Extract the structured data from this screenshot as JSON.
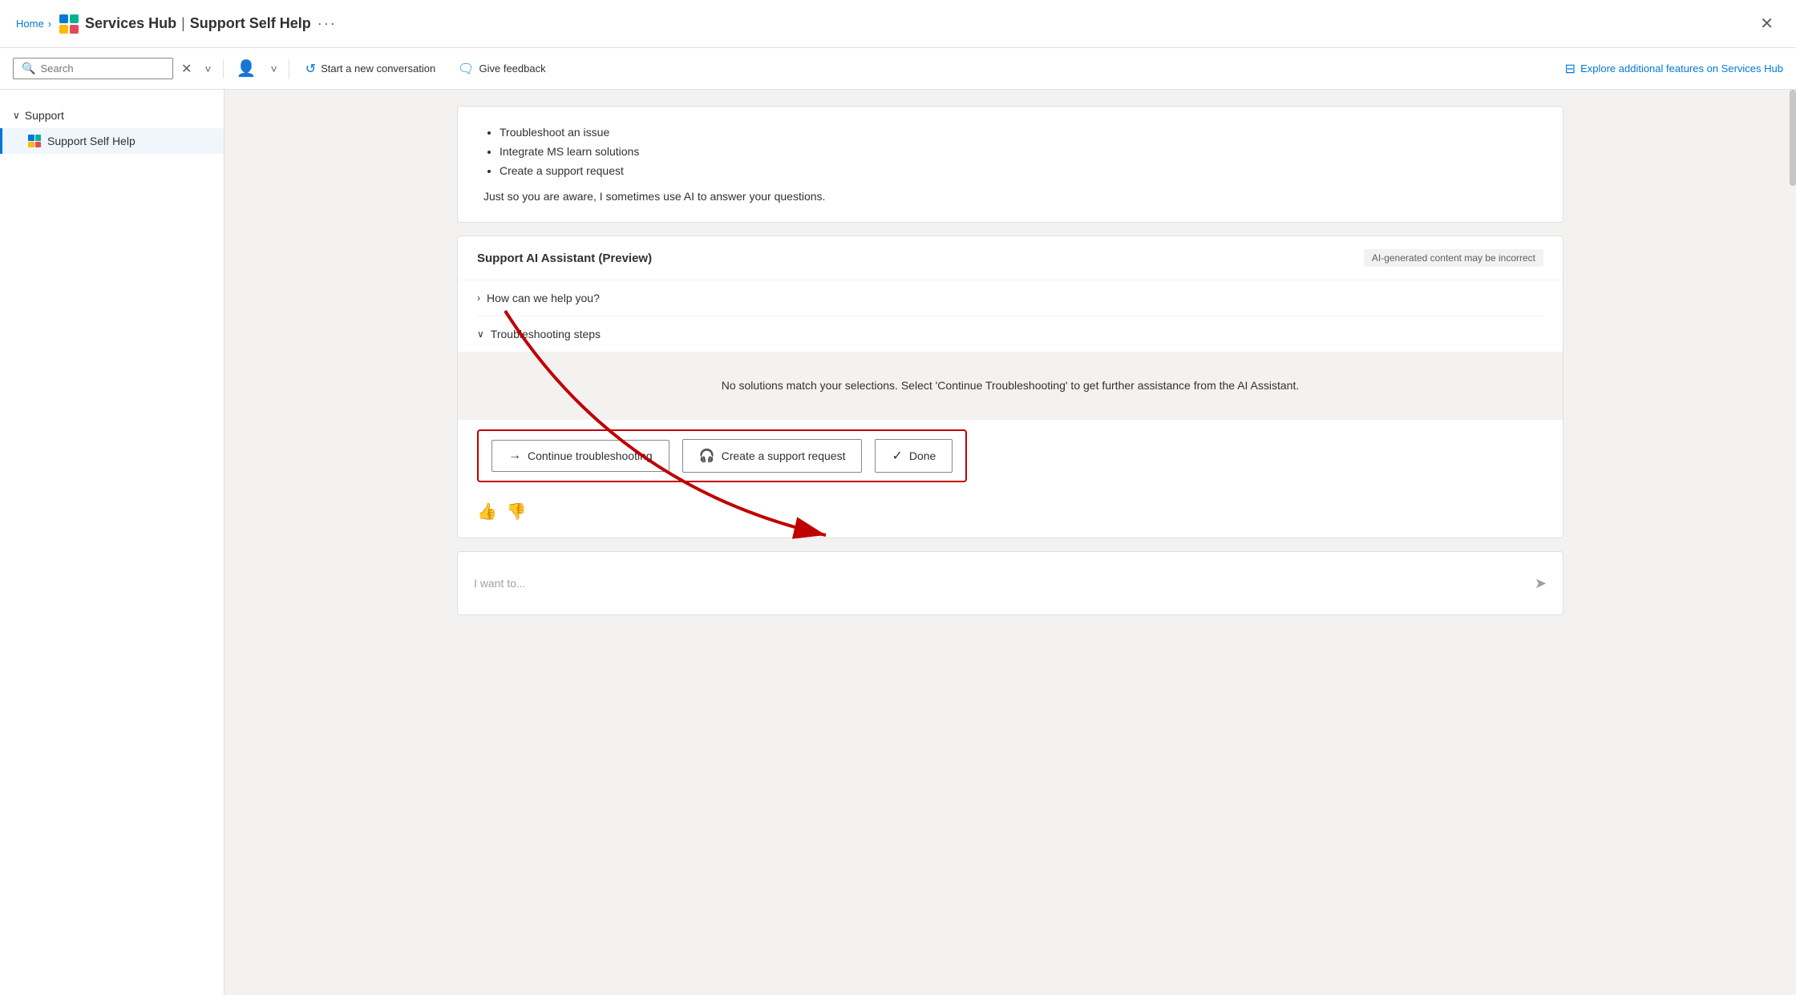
{
  "titleBar": {
    "breadcrumb": "Home",
    "chevron": "›",
    "appName": "Services Hub",
    "pipe": "|",
    "subtitle": "Support Self Help",
    "ellipsis": "···",
    "close": "✕"
  },
  "toolbar": {
    "search": {
      "placeholder": "Search",
      "icon": "🔍"
    },
    "closeIcon": "✕",
    "chevronIcon": "˅",
    "userIcon": "👤",
    "startNew": "Start a new conversation",
    "giveFeedback": "Give feedback",
    "explore": "Explore additional features on Services Hub"
  },
  "sidebar": {
    "groupLabel": "Support",
    "activeItem": "Support Self Help"
  },
  "chat": {
    "bullets": [
      "Troubleshoot an issue",
      "Integrate MS learn solutions",
      "Create a support request"
    ],
    "disclaimer": "Just so you are aware, I sometimes use AI to answer your questions.",
    "aiAssistant": {
      "title": "Support AI Assistant (Preview)",
      "aiNote": "AI-generated content may be incorrect",
      "helpRow": "How can we help you?",
      "troubleshootingRow": "Troubleshooting steps",
      "noSolutionsMessage": "No solutions match your selections. Select 'Continue Troubleshooting' to get further assistance from the AI Assistant.",
      "buttons": {
        "continue": "Continue troubleshooting",
        "createRequest": "Create a support request",
        "done": "Done"
      }
    },
    "inputPlaceholder": "I want to..."
  }
}
